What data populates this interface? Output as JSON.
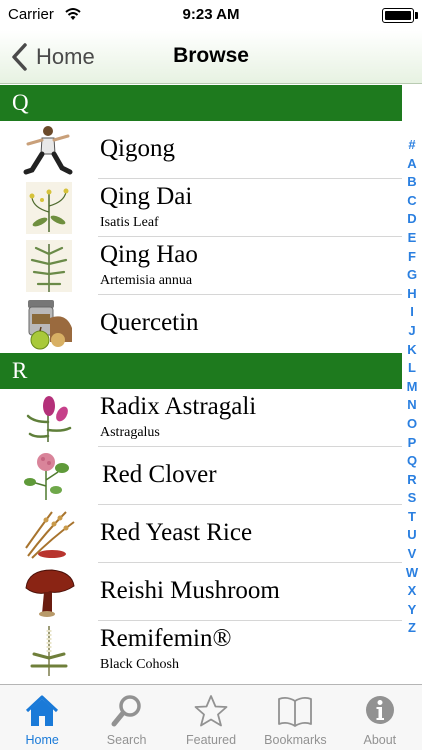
{
  "status_bar": {
    "carrier": "Carrier",
    "time": "9:23 AM"
  },
  "nav": {
    "back_label": "Home",
    "title": "Browse"
  },
  "sections": [
    {
      "letter": "Q",
      "items": [
        {
          "title": "Qigong",
          "subtitle": "",
          "icon": "tai-chi-person-icon"
        },
        {
          "title": "Qing Dai",
          "subtitle": "Isatis Leaf",
          "icon": "isatis-plant-icon"
        },
        {
          "title": "Qing Hao",
          "subtitle": "Artemisia annua",
          "icon": "artemisia-plant-icon"
        },
        {
          "title": "Quercetin",
          "subtitle": "",
          "icon": "apple-jar-icon"
        }
      ]
    },
    {
      "letter": "R",
      "items": [
        {
          "title": "Radix Astragali",
          "subtitle": "Astragalus",
          "icon": "astragalus-plant-icon"
        },
        {
          "title": "Red Clover",
          "subtitle": "",
          "icon": "red-clover-icon"
        },
        {
          "title": "Red Yeast Rice",
          "subtitle": "",
          "icon": "rice-stalk-icon"
        },
        {
          "title": "Reishi Mushroom",
          "subtitle": "",
          "icon": "mushroom-icon"
        },
        {
          "title": "Remifemin®",
          "subtitle": "Black Cohosh",
          "icon": "black-cohosh-icon"
        }
      ]
    }
  ],
  "index_letters": [
    "#",
    "A",
    "B",
    "C",
    "D",
    "E",
    "F",
    "G",
    "H",
    "I",
    "J",
    "K",
    "L",
    "M",
    "N",
    "O",
    "P",
    "Q",
    "R",
    "S",
    "T",
    "U",
    "V",
    "W",
    "X",
    "Y",
    "Z"
  ],
  "tabs": [
    {
      "label": "Home",
      "icon": "house-icon",
      "active": true
    },
    {
      "label": "Search",
      "icon": "magnifier-icon",
      "active": false
    },
    {
      "label": "Featured",
      "icon": "star-icon",
      "active": false
    },
    {
      "label": "Bookmarks",
      "icon": "book-icon",
      "active": false
    },
    {
      "label": "About",
      "icon": "info-icon",
      "active": false
    }
  ],
  "colors": {
    "section_header": "#1e7a1e",
    "accent": "#1a7ad8",
    "index_blue": "#2a7fe0"
  }
}
